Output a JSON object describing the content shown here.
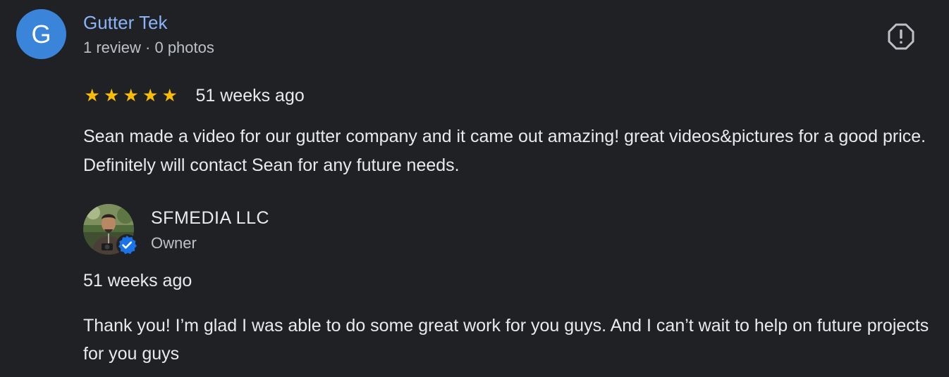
{
  "review": {
    "avatar_letter": "G",
    "avatar_color": "#3a84d9",
    "reviewer_name": "Gutter Tek",
    "reviewer_meta": "1 review · 0 photos",
    "report_icon": "report-flag-icon",
    "rating": 5,
    "rating_max": 5,
    "star_glyph": "★",
    "star_color": "#fbbc04",
    "date": "51 weeks ago",
    "text": "Sean made a video for our gutter company and it came out amazing! great videos&pictures for a good price. Definitely will contact Sean for any future needs."
  },
  "response": {
    "owner_name": "SFMEDIA LLC",
    "owner_role": "Owner",
    "verified_icon": "verified-badge-icon",
    "date": "51 weeks ago",
    "text": "Thank you! I’m glad I was able to do some great work for you guys. And I can’t wait to help on future projects for you guys"
  },
  "colors": {
    "background": "#202124",
    "name_link": "#8ab4f8",
    "text": "#e8eaed",
    "secondary_text": "#bdc1c6",
    "verified": "#1a73e8"
  }
}
